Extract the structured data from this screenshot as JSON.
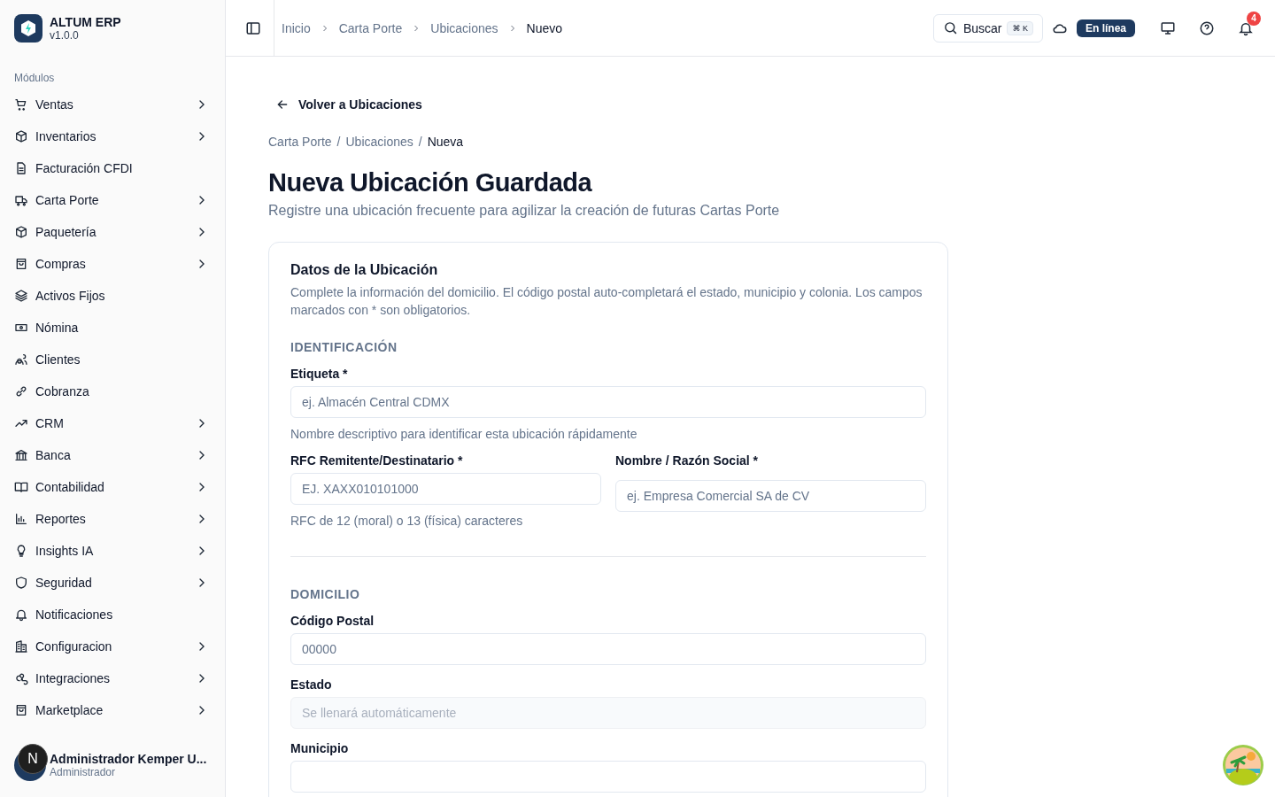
{
  "app": {
    "name": "ALTUM ERP",
    "version": "v1.0.0"
  },
  "sidebar": {
    "section": "Módulos",
    "items": [
      {
        "label": "Ventas",
        "expandable": true
      },
      {
        "label": "Inventarios",
        "expandable": true
      },
      {
        "label": "Facturación CFDI",
        "expandable": false
      },
      {
        "label": "Carta Porte",
        "expandable": true
      },
      {
        "label": "Paquetería",
        "expandable": true
      },
      {
        "label": "Compras",
        "expandable": true
      },
      {
        "label": "Activos Fijos",
        "expandable": false
      },
      {
        "label": "Nómina",
        "expandable": false
      },
      {
        "label": "Clientes",
        "expandable": false
      },
      {
        "label": "Cobranza",
        "expandable": false
      },
      {
        "label": "CRM",
        "expandable": true
      },
      {
        "label": "Banca",
        "expandable": true
      },
      {
        "label": "Contabilidad",
        "expandable": true
      },
      {
        "label": "Reportes",
        "expandable": true
      },
      {
        "label": "Insights IA",
        "expandable": true
      },
      {
        "label": "Seguridad",
        "expandable": true
      },
      {
        "label": "Notificaciones",
        "expandable": false
      },
      {
        "label": "Configuracion",
        "expandable": true
      },
      {
        "label": "Integraciones",
        "expandable": true
      },
      {
        "label": "Marketplace",
        "expandable": true
      }
    ],
    "user": {
      "initial": "N",
      "name": "Administrador Kemper U...",
      "role": "Administrador"
    }
  },
  "header": {
    "breadcrumb": [
      "Inicio",
      "Carta Porte",
      "Ubicaciones",
      "Nuevo"
    ],
    "search": {
      "label": "Buscar",
      "shortcut": "⌘ K"
    },
    "status": "En línea",
    "notifications": "4"
  },
  "page": {
    "back": "Volver a Ubicaciones",
    "separator": "/",
    "breadcrumb": [
      "Carta Porte",
      "Ubicaciones",
      "Nueva"
    ],
    "title": "Nueva Ubicación Guardada",
    "subtitle": "Registre una ubicación frecuente para agilizar la creación de futuras Cartas Porte"
  },
  "card": {
    "title": "Datos de la Ubicación",
    "description": "Complete la información del domicilio. El código postal auto-completará el estado, municipio y colonia. Los campos marcados con * son obligatorios.",
    "sections": [
      {
        "heading": "IDENTIFICACIÓN",
        "rows": [
          [
            {
              "label": "Etiqueta *",
              "placeholder": "ej. Almacén Central CDMX",
              "hint": "Nombre descriptivo para identificar esta ubicación rápidamente",
              "disabled": false
            }
          ],
          [
            {
              "label": "RFC Remitente/Destinatario *",
              "placeholder": "EJ. XAXX010101000",
              "hint": "RFC de 12 (moral) o 13 (física) caracteres",
              "disabled": false
            },
            {
              "label": "Nombre / Razón Social *",
              "placeholder": "ej. Empresa Comercial SA de CV",
              "disabled": false
            }
          ]
        ]
      },
      {
        "heading": "DOMICILIO",
        "rows": [
          [
            {
              "label": "Código Postal",
              "placeholder": "00000",
              "disabled": false
            }
          ],
          [
            {
              "label": "Estado",
              "placeholder": "Se llenará automáticamente",
              "disabled": true
            }
          ],
          [
            {
              "label": "Municipio",
              "disabled": false
            }
          ]
        ]
      }
    ]
  }
}
